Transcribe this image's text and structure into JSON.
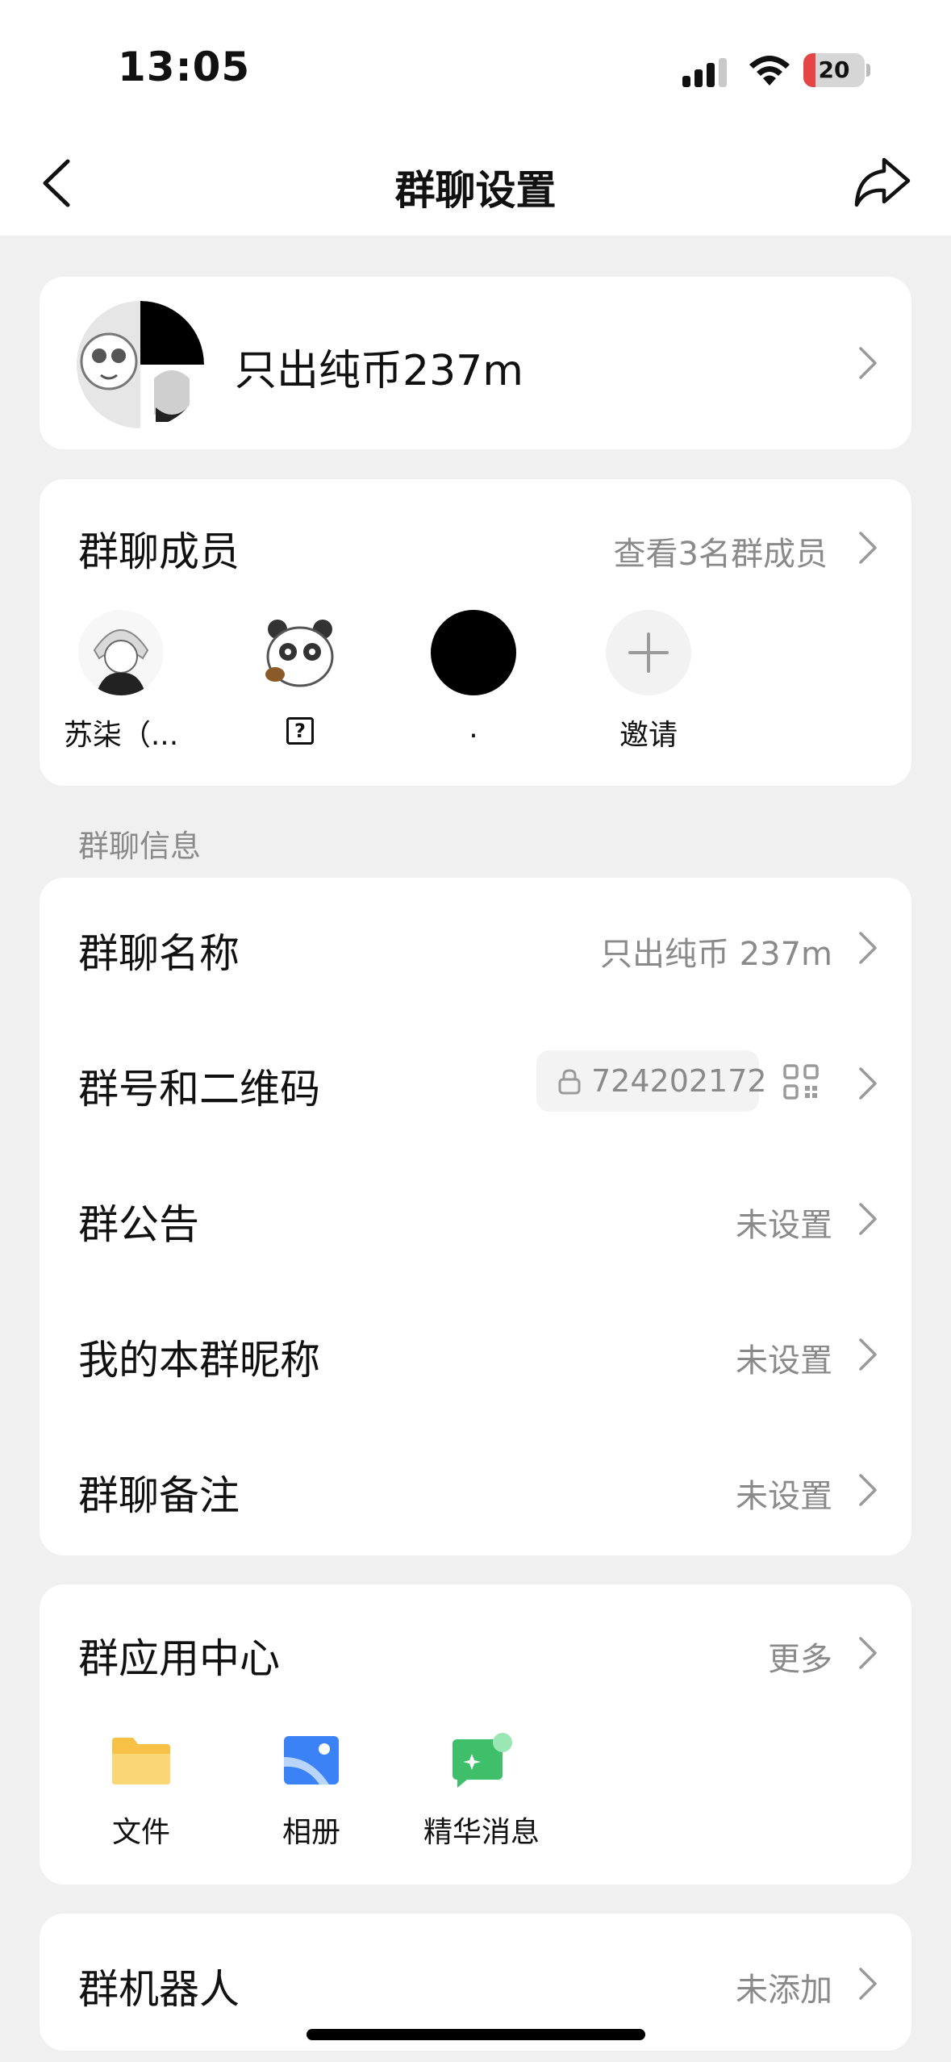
{
  "status_bar": {
    "time": "13:05",
    "battery_level": "20",
    "signal_icon": "cellular-signal-icon",
    "wifi_icon": "wifi-icon",
    "battery_color": "#e54545"
  },
  "nav": {
    "title": "群聊设置",
    "back_icon": "chevron-left-icon",
    "share_icon": "share-arrow-icon"
  },
  "group": {
    "name": "只出纯币237m"
  },
  "members": {
    "title": "群聊成员",
    "view_all": "查看3名群成员",
    "items": [
      {
        "name": "苏柒（..."
      },
      {
        "name": "?"
      },
      {
        "name": "."
      }
    ],
    "invite_label": "邀请"
  },
  "info_section": {
    "header": "群聊信息",
    "rows": [
      {
        "label": "群聊名称",
        "value": "只出纯币 237m"
      },
      {
        "label": "群号和二维码",
        "value": "724202172"
      },
      {
        "label": "群公告",
        "value": "未设置"
      },
      {
        "label": "我的本群昵称",
        "value": "未设置"
      },
      {
        "label": "群聊备注",
        "value": "未设置"
      }
    ]
  },
  "apps": {
    "title": "群应用中心",
    "more": "更多",
    "items": [
      {
        "label": "文件",
        "icon": "folder-icon",
        "color": "#f6c144"
      },
      {
        "label": "相册",
        "icon": "photo-album-icon",
        "color": "#3b82f6"
      },
      {
        "label": "精华消息",
        "icon": "featured-message-icon",
        "color": "#3fbf6a"
      }
    ]
  },
  "robot": {
    "label": "群机器人",
    "value": "未添加"
  },
  "colors": {
    "background": "#f0f0f0",
    "card": "#ffffff",
    "secondary_text": "#8a8a8a"
  }
}
